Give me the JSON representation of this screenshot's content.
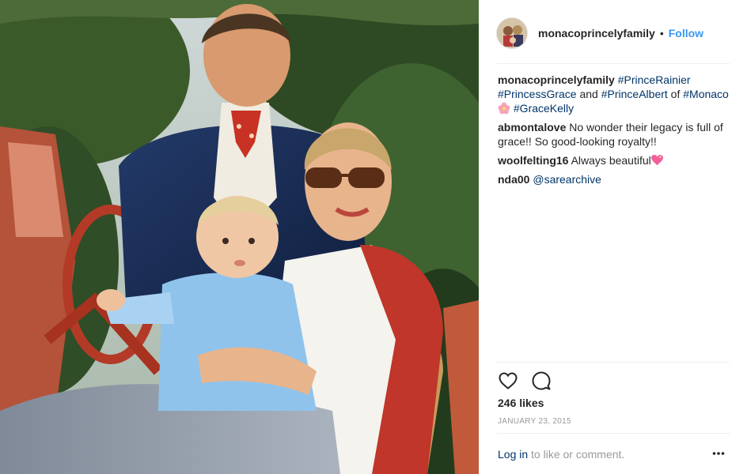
{
  "post": {
    "username": "monacoprincelyfamily",
    "separator": "•",
    "follow_label": "Follow"
  },
  "caption": {
    "username": "monacoprincelyfamily",
    "hashtags": [
      "#PrinceRainier",
      "#PrincessGrace",
      "#PrinceAlbert",
      "#Monaco",
      "#GraceKelly"
    ],
    "and_text": "and",
    "of_text": "of",
    "emoji": "flower-emoji"
  },
  "comments": [
    {
      "user": "abmontalove",
      "text": "No wonder their legacy is full of grace!! So good-looking royalty!!"
    },
    {
      "user": "woolfelting16",
      "text": "Always beautiful",
      "emoji": "sparkling-heart-emoji"
    },
    {
      "user": "nda00",
      "mention": "@sarearchive"
    }
  ],
  "actions": {
    "like_icon": "heart-outline-icon",
    "comment_icon": "comment-bubble-icon"
  },
  "likes_text": "246 likes",
  "date_text": "JANUARY 23, 2015",
  "login": {
    "link": "Log in",
    "rest": "to like or comment."
  },
  "more_icon": "ellipsis-icon",
  "colors": {
    "link_blue": "#3897f0",
    "hashtag": "#003569",
    "muted": "#999999",
    "text": "#262626"
  }
}
